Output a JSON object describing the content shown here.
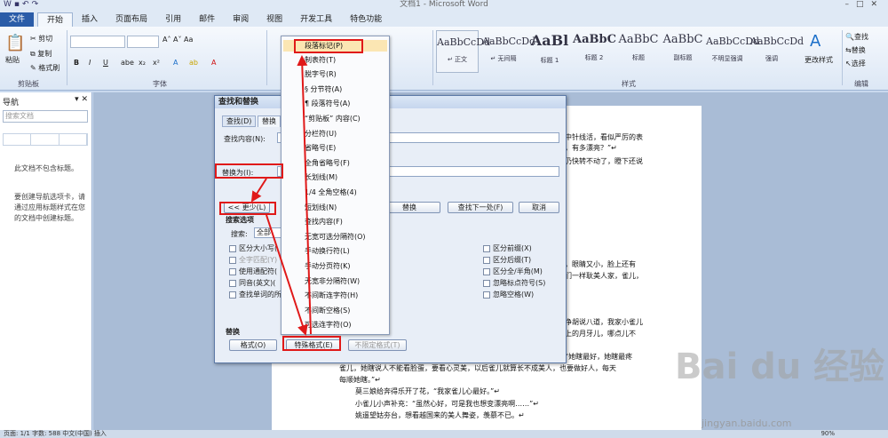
{
  "window": {
    "title": "文档1 - Microsoft Word"
  },
  "tabs": [
    "文件",
    "开始",
    "插入",
    "页面布局",
    "引用",
    "邮件",
    "审阅",
    "视图",
    "开发工具",
    "特色功能"
  ],
  "clipboard": {
    "paste": "粘贴",
    "cut": "剪切",
    "copy": "复制",
    "format_painter": "格式刷",
    "group": "剪贴板"
  },
  "font": {
    "group": "字体",
    "buttons": [
      "B",
      "I",
      "U",
      "abe",
      "x₂",
      "x²"
    ]
  },
  "styles": {
    "group": "样式",
    "items": [
      {
        "preview": "AaBbCcDd",
        "name": "↵ 正文"
      },
      {
        "preview": "AaBbCcDd",
        "name": "↵ 无间隔"
      },
      {
        "preview": "AaBl",
        "name": "标题 1"
      },
      {
        "preview": "AaBbC",
        "name": "标题 2"
      },
      {
        "preview": "AaBbC",
        "name": "标题"
      },
      {
        "preview": "AaBbC",
        "name": "副标题"
      },
      {
        "preview": "AaBbCcDd",
        "name": "不明显强调"
      },
      {
        "preview": "AaBbCcDd",
        "name": "强调"
      }
    ],
    "change": "更改样式"
  },
  "editing": {
    "group": "编辑",
    "find": "查找",
    "replace": "替换",
    "select": "选择"
  },
  "nav": {
    "title": "导航",
    "search_placeholder": "搜索文档",
    "message": "此文档不包含标题。",
    "hint": "要创建导航选项卡，请通过应用标题样式在您的文档中创建标题。"
  },
  "document": {
    "lines": [
      "中针线活，看似严厉的表",
      "，有多漂亮？”↵",
      "仍快转不动了，瞪下还说",
      "，眼睛又小，脸上还有",
      "们一样耿美人家，雀儿，",
      "净胡说八道，我家小雀儿",
      "上的月牙儿，哪点儿不",
      "“她瞎最好，她瞎最疼",
      "雀儿，她瞎说人不能看脸蛋，要看心灵美，以后雀儿就算长不成美人，也要做好人，每天",
      "每顺她瞎。”↵",
      "莫三娘给奔得乐开了花，“我家雀儿心最好。”↵",
      "小雀儿小声补充：“虽然心好，可是我也想变漂亮啊……”↵",
      "姚遥望姑夯台，想看越国来的美人舞姿，羡慕不已。↵"
    ]
  },
  "dialog": {
    "title": "查找和替换",
    "tab_find": "查找(D)",
    "tab_replace": "替换",
    "find_label": "查找内容(N):",
    "replace_label": "替换为(I):",
    "less_button": "<< 更少(L)",
    "search_options": "搜索选项",
    "search_label": "搜索:",
    "search_value": "全部",
    "replace_btn": "替换",
    "find_next": "查找下一处(F)",
    "cancel": "取消",
    "left_checks": [
      "区分大小写(",
      "全字匹配(Y)",
      "使用通配符(",
      "同音(英文)(",
      "查找单词的所"
    ],
    "right_checks": [
      "区分前缀(X)",
      "区分后缀(T)",
      "区分全/半角(M)",
      "忽略标点符号(S)",
      "忽略空格(W)"
    ],
    "replace_section": "替换",
    "format_button": "格式(O)",
    "special_button": "特殊格式(E)",
    "no_format_button": "不限定格式(T)"
  },
  "special_menu": {
    "items": [
      "段落标记(P)",
      "制表符(T)",
      "脱字号(R)",
      "§ 分节符(A)",
      "¶ 段落符号(A)",
      "“剪贴板” 内容(C)",
      "分栏符(U)",
      "省略号(E)",
      "全角省略号(F)",
      "长划线(M)",
      "1/4 全角空格(4)",
      "短划线(N)",
      "查找内容(F)",
      "无宽可选分隔符(O)",
      "手动换行符(L)",
      "手动分页符(K)",
      "无宽非分隔符(W)",
      "不间断连字符(H)",
      "不间断空格(S)",
      "可选连字符(O)"
    ]
  },
  "status": {
    "text": "页面: 1/1   字数: 588   中文(中国)   插入",
    "zoom": "90%"
  },
  "watermark": {
    "logo": "Bai du 经验",
    "url": "jingyan.baidu.com"
  },
  "colors": {
    "accent": "#2a5ca8",
    "annotation": "#e01919"
  }
}
